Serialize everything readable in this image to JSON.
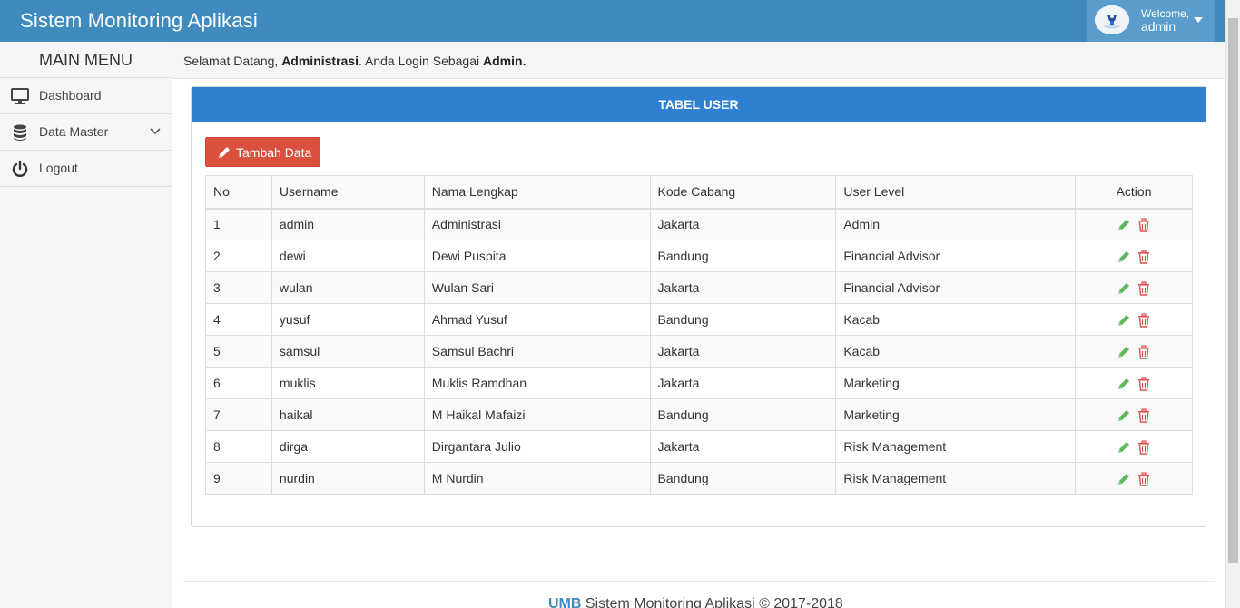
{
  "header": {
    "title": "Sistem Monitoring Aplikasi",
    "welcome_label": "Welcome,",
    "username": "admin"
  },
  "sidebar": {
    "heading": "MAIN MENU",
    "items": [
      {
        "label": "Dashboard",
        "icon": "monitor-icon"
      },
      {
        "label": "Data Master",
        "icon": "database-icon"
      },
      {
        "label": "Logout",
        "icon": "power-icon"
      }
    ]
  },
  "greeting": {
    "prefix": "Selamat Datang,",
    "name": "Administrasi",
    "middle": ". Anda Login Sebagai",
    "role": "Admin",
    "suffix": "."
  },
  "panel": {
    "title": "TABEL USER",
    "add_button": "Tambah Data",
    "columns": [
      "No",
      "Username",
      "Nama Lengkap",
      "Kode Cabang",
      "User Level",
      "Action"
    ],
    "rows": [
      {
        "no": "1",
        "username": "admin",
        "nama": "Administrasi",
        "cabang": "Jakarta",
        "level": "Admin"
      },
      {
        "no": "2",
        "username": "dewi",
        "nama": "Dewi Puspita",
        "cabang": "Bandung",
        "level": "Financial Advisor"
      },
      {
        "no": "3",
        "username": "wulan",
        "nama": "Wulan Sari",
        "cabang": "Jakarta",
        "level": "Financial Advisor"
      },
      {
        "no": "4",
        "username": "yusuf",
        "nama": "Ahmad Yusuf",
        "cabang": "Bandung",
        "level": "Kacab"
      },
      {
        "no": "5",
        "username": "samsul",
        "nama": "Samsul Bachri",
        "cabang": "Jakarta",
        "level": "Kacab"
      },
      {
        "no": "6",
        "username": "muklis",
        "nama": "Muklis Ramdhan",
        "cabang": "Jakarta",
        "level": "Marketing"
      },
      {
        "no": "7",
        "username": "haikal",
        "nama": "M Haikal Mafaizi",
        "cabang": "Bandung",
        "level": "Marketing"
      },
      {
        "no": "8",
        "username": "dirga",
        "nama": "Dirgantara Julio",
        "cabang": "Jakarta",
        "level": "Risk Management"
      },
      {
        "no": "9",
        "username": "nurdin",
        "nama": "M Nurdin",
        "cabang": "Bandung",
        "level": "Risk Management"
      }
    ]
  },
  "footer": {
    "brand": "UMB",
    "text": "Sistem Monitoring Aplikasi © 2017-2018"
  },
  "colors": {
    "navbar": "#3f8bbd",
    "panel_header": "#2f80d0",
    "add_button": "#d9503f",
    "edit_icon": "#5cb85c",
    "delete_icon": "#d9534f"
  }
}
